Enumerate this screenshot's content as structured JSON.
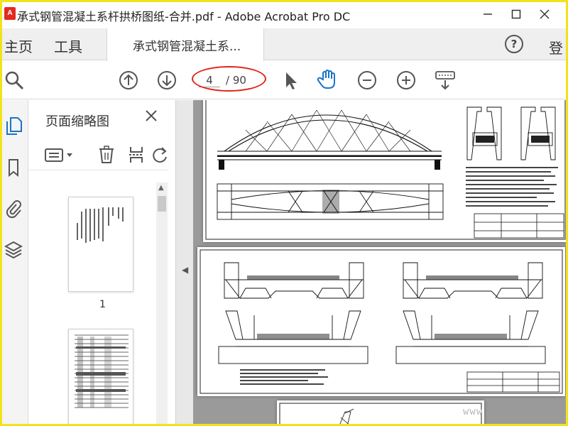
{
  "window": {
    "title": "承式钢管混凝土系杆拱桥图纸-合并.pdf - Adobe Acrobat Pro DC",
    "app_icon": "pdf-icon"
  },
  "tabs": {
    "home": "主页",
    "tools": "工具",
    "document": "承式钢管混凝土系...",
    "login": "登"
  },
  "toolbar": {
    "page_current": "4",
    "page_total": "/ 90",
    "highlight_color": "#e2231a"
  },
  "thumbnail_panel": {
    "title": "页面缩略图",
    "thumbnail_1_label": "1"
  },
  "watermark": "www",
  "colors": {
    "frame": "#f2e21a",
    "app_red": "#e02b20",
    "active_blue": "#1a73c8"
  }
}
